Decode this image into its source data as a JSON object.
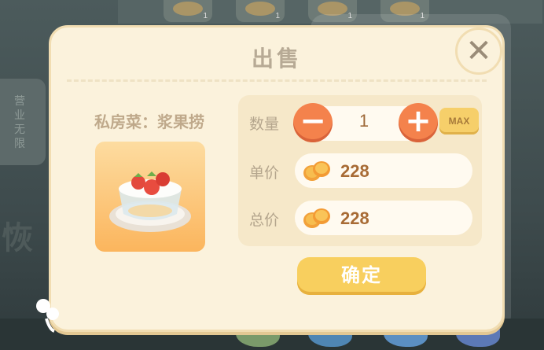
{
  "dialog": {
    "title": "出售",
    "dish_name": "私房菜：浆果捞",
    "dish_image_icon": "berry-dessert-bowl-icon",
    "close_icon": "close-x-icon"
  },
  "quantity": {
    "label": "数量",
    "value": "1",
    "minus_label": "−",
    "plus_label": "+",
    "max_label": "MAX"
  },
  "unit_price": {
    "label": "单价",
    "value": "228",
    "icon": "gold-coin-icon"
  },
  "total_price": {
    "label": "总价",
    "value": "228",
    "icon": "gold-coin-icon"
  },
  "confirm_label": "确定",
  "background": {
    "slot_counts": [
      "1",
      "1",
      "1",
      "1"
    ],
    "left_tag_text": "营业无限",
    "left_big_text": "恢"
  },
  "colors": {
    "dialog_bg": "#fbf2dc",
    "accent_orange": "#f4824c",
    "confirm_yellow": "#f8cf5e",
    "price_text": "#a86b35"
  }
}
